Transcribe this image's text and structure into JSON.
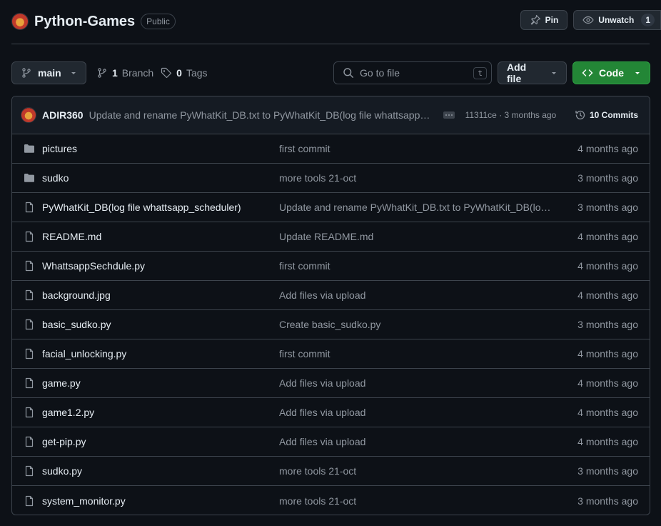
{
  "repo": {
    "name": "Python-Games",
    "visibility": "Public"
  },
  "header_actions": {
    "pin_label": "Pin",
    "unwatch_label": "Unwatch",
    "watch_count": "1"
  },
  "toolbar": {
    "branch": "main",
    "branch_count": "1",
    "branch_label": "Branch",
    "tag_count": "0",
    "tag_label": "Tags",
    "search_placeholder": "Go to file",
    "search_shortcut": "t",
    "add_file_label": "Add file",
    "code_label": "Code"
  },
  "latest_commit": {
    "author": "ADIR360",
    "message": "Update and rename PyWhatKit_DB.txt to PyWhatKit_DB(log file whattsapp_scheduler)",
    "hash_and_time": "11311ce · 3 months ago",
    "commits_label": "10 Commits"
  },
  "files": [
    {
      "type": "folder",
      "name": "pictures",
      "commit": "first commit",
      "time": "4 months ago"
    },
    {
      "type": "folder",
      "name": "sudko",
      "commit": "more tools 21-oct",
      "time": "3 months ago"
    },
    {
      "type": "file",
      "name": "PyWhatKit_DB(log file whattsapp_scheduler)",
      "commit": "Update and rename PyWhatKit_DB.txt to PyWhatKit_DB(log file whattsapp_scheduler)",
      "time": "3 months ago"
    },
    {
      "type": "file",
      "name": "README.md",
      "commit": "Update README.md",
      "time": "4 months ago"
    },
    {
      "type": "file",
      "name": "WhattsappSechdule.py",
      "commit": "first commit",
      "time": "4 months ago"
    },
    {
      "type": "file",
      "name": "background.jpg",
      "commit": "Add files via upload",
      "time": "4 months ago"
    },
    {
      "type": "file",
      "name": "basic_sudko.py",
      "commit": "Create basic_sudko.py",
      "time": "3 months ago"
    },
    {
      "type": "file",
      "name": "facial_unlocking.py",
      "commit": "first commit",
      "time": "4 months ago"
    },
    {
      "type": "file",
      "name": "game.py",
      "commit": "Add files via upload",
      "time": "4 months ago"
    },
    {
      "type": "file",
      "name": "game1.2.py",
      "commit": "Add files via upload",
      "time": "4 months ago"
    },
    {
      "type": "file",
      "name": "get-pip.py",
      "commit": "Add files via upload",
      "time": "4 months ago"
    },
    {
      "type": "file",
      "name": "sudko.py",
      "commit": "more tools 21-oct",
      "time": "3 months ago"
    },
    {
      "type": "file",
      "name": "system_monitor.py",
      "commit": "more tools 21-oct",
      "time": "3 months ago"
    }
  ],
  "colors": {
    "background": "#0d1117",
    "border": "#3d444d",
    "muted_text": "#9198a1",
    "code_button": "#238636",
    "folder_icon": "#9198a1"
  }
}
